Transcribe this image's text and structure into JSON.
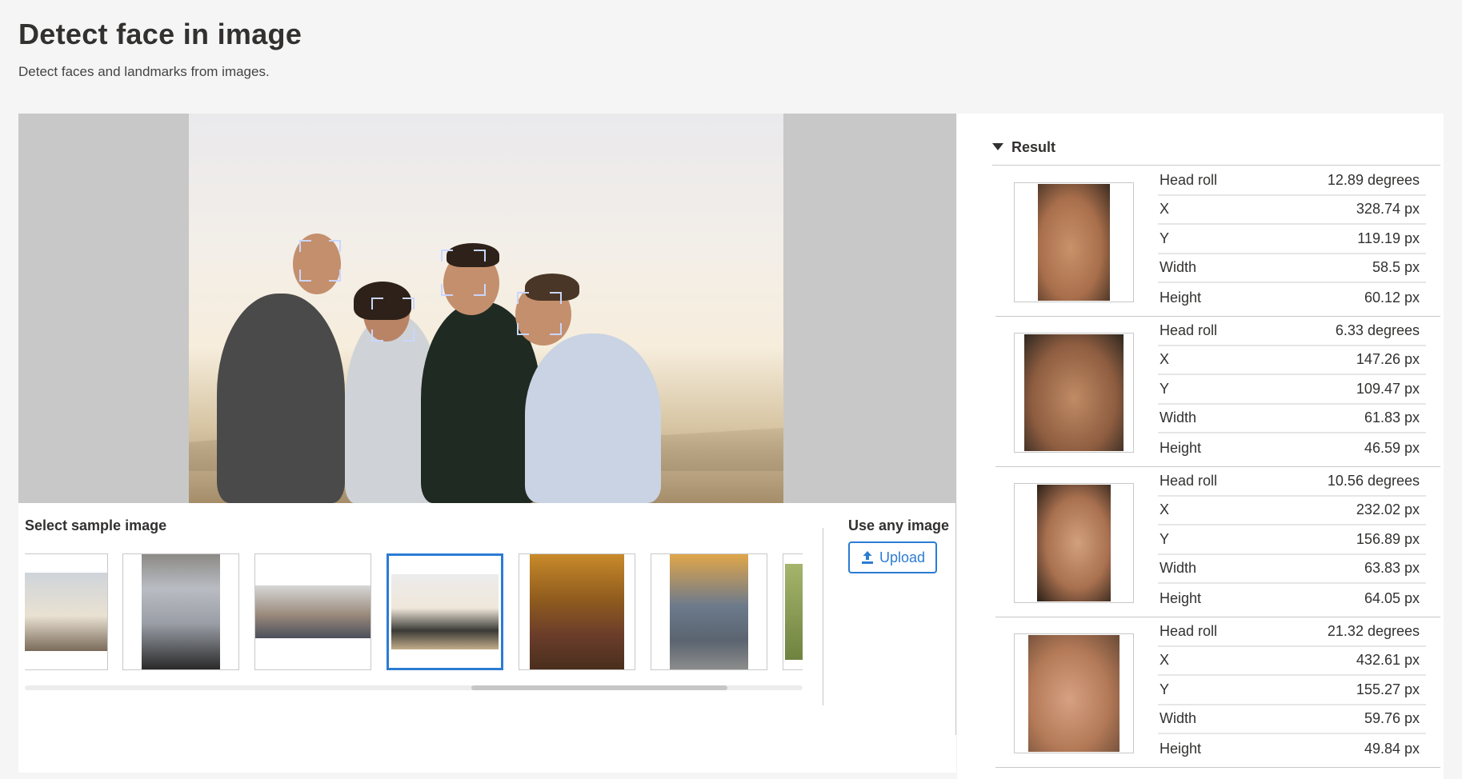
{
  "header": {
    "title": "Detect face in image",
    "subtitle": "Detect faces and landmarks from images."
  },
  "samples": {
    "label": "Select sample image",
    "selected_index": 3
  },
  "upload": {
    "label": "Use any image",
    "button_label": "Upload"
  },
  "result": {
    "title": "Result",
    "faces": [
      {
        "head_roll_label": "Head roll",
        "head_roll": "12.89 degrees",
        "x_label": "X",
        "x": "328.74 px",
        "y_label": "Y",
        "y": "119.19 px",
        "width_label": "Width",
        "width": "58.5 px",
        "height_label": "Height",
        "height": "60.12 px"
      },
      {
        "head_roll_label": "Head roll",
        "head_roll": "6.33 degrees",
        "x_label": "X",
        "x": "147.26 px",
        "y_label": "Y",
        "y": "109.47 px",
        "width_label": "Width",
        "width": "61.83 px",
        "height_label": "Height",
        "height": "46.59 px"
      },
      {
        "head_roll_label": "Head roll",
        "head_roll": "10.56 degrees",
        "x_label": "X",
        "x": "232.02 px",
        "y_label": "Y",
        "y": "156.89 px",
        "width_label": "Width",
        "width": "63.83 px",
        "height_label": "Height",
        "height": "64.05 px"
      },
      {
        "head_roll_label": "Head roll",
        "head_roll": "21.32 degrees",
        "x_label": "X",
        "x": "432.61 px",
        "y_label": "Y",
        "y": "155.27 px",
        "width_label": "Width",
        "width": "59.76 px",
        "height_label": "Height",
        "height": "49.84 px"
      }
    ]
  },
  "icons": {
    "upload": "upload-icon",
    "collapse": "caret-down-icon"
  },
  "colors": {
    "accent": "#2b7cd3",
    "face_box": "#c9d6ff",
    "preview_bg": "#c8c8c8"
  }
}
